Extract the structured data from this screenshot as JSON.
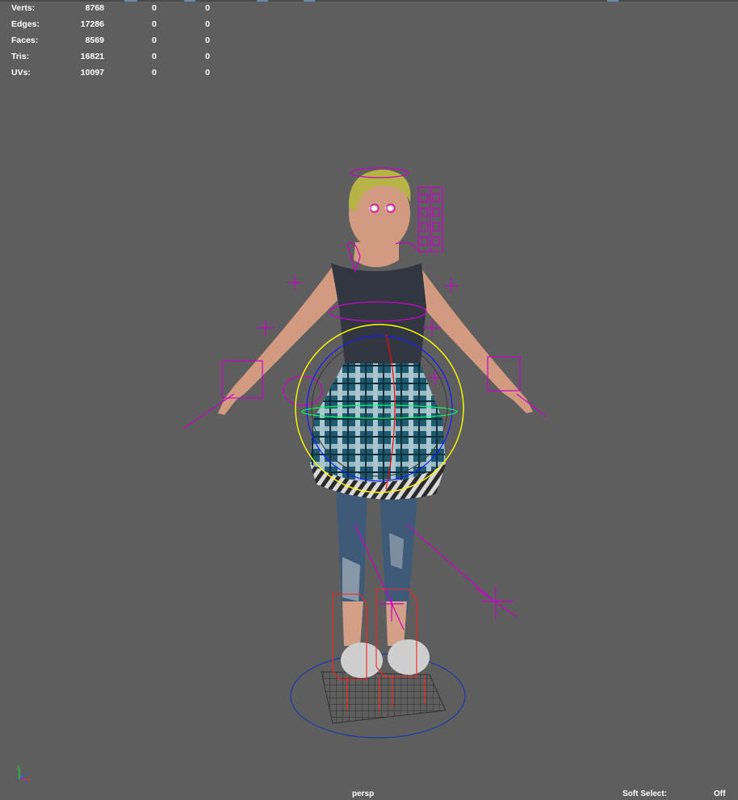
{
  "hud": {
    "rows": [
      {
        "label": "Verts:",
        "total": "8768",
        "selected": "0",
        "third": "0"
      },
      {
        "label": "Edges:",
        "total": "17286",
        "selected": "0",
        "third": "0"
      },
      {
        "label": "Faces:",
        "total": "8569",
        "selected": "0",
        "third": "0"
      },
      {
        "label": "Tris:",
        "total": "16821",
        "selected": "0",
        "third": "0"
      },
      {
        "label": "UVs:",
        "total": "10097",
        "selected": "0",
        "third": "0"
      }
    ]
  },
  "viewport": {
    "camera": "persp",
    "soft_select_label": "Soft Select:",
    "soft_select_value": "Off"
  },
  "colors": {
    "background": "#5e5e5e",
    "rig_control": "#cc00cc",
    "selection_ring": "#ffff00",
    "root_ring": "#1a3aa8",
    "ik_box": "#ff0000"
  },
  "axis_indicator": {
    "y": "y",
    "z": "z"
  }
}
